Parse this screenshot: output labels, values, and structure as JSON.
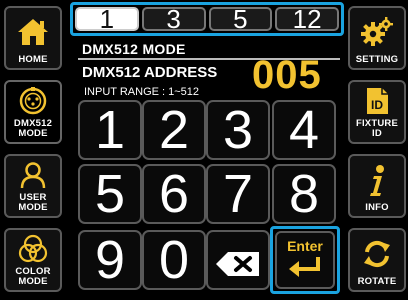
{
  "left_menu": [
    {
      "id": "home",
      "label": "HOME",
      "icon": "home-icon"
    },
    {
      "id": "dmx512-mode",
      "label": "DMX512\nMODE",
      "icon": "dmx-connector-icon"
    },
    {
      "id": "user-mode",
      "label": "USER\nMODE",
      "icon": "user-icon"
    },
    {
      "id": "color-mode",
      "label": "COLOR\nMODE",
      "icon": "color-circles-icon"
    }
  ],
  "right_menu": [
    {
      "id": "setting",
      "label": "SETTING",
      "icon": "gears-icon"
    },
    {
      "id": "fixture-id",
      "label": "FIXTURE\nID",
      "icon": "id-card-icon"
    },
    {
      "id": "info",
      "label": "INFO",
      "icon": "info-icon"
    },
    {
      "id": "rotate",
      "label": "ROTATE",
      "icon": "rotate-icon"
    }
  ],
  "channel_tabs": [
    "1",
    "3",
    "5",
    "12"
  ],
  "active_tab": "1",
  "mode_title": "DMX512 MODE",
  "address_label": "DMX512 ADDRESS",
  "address_value": "005",
  "range_label": "INPUT RANGE : 1~512",
  "keypad": {
    "digits": [
      "1",
      "2",
      "3",
      "4",
      "5",
      "6",
      "7",
      "8",
      "9",
      "0"
    ],
    "backspace_icon": "backspace-icon",
    "enter_label": "Enter",
    "enter_icon": "return-arrow-icon"
  },
  "colors": {
    "accent_highlight": "#1aa3e0",
    "address_value": "#f2c230",
    "home_icon": "#f2c230",
    "gears_icon": "#f2c230",
    "dmx_icon": "#f2c230",
    "user_icon": "#f2c230",
    "color_icon": "#f2c230",
    "enter": "#f2c230"
  }
}
